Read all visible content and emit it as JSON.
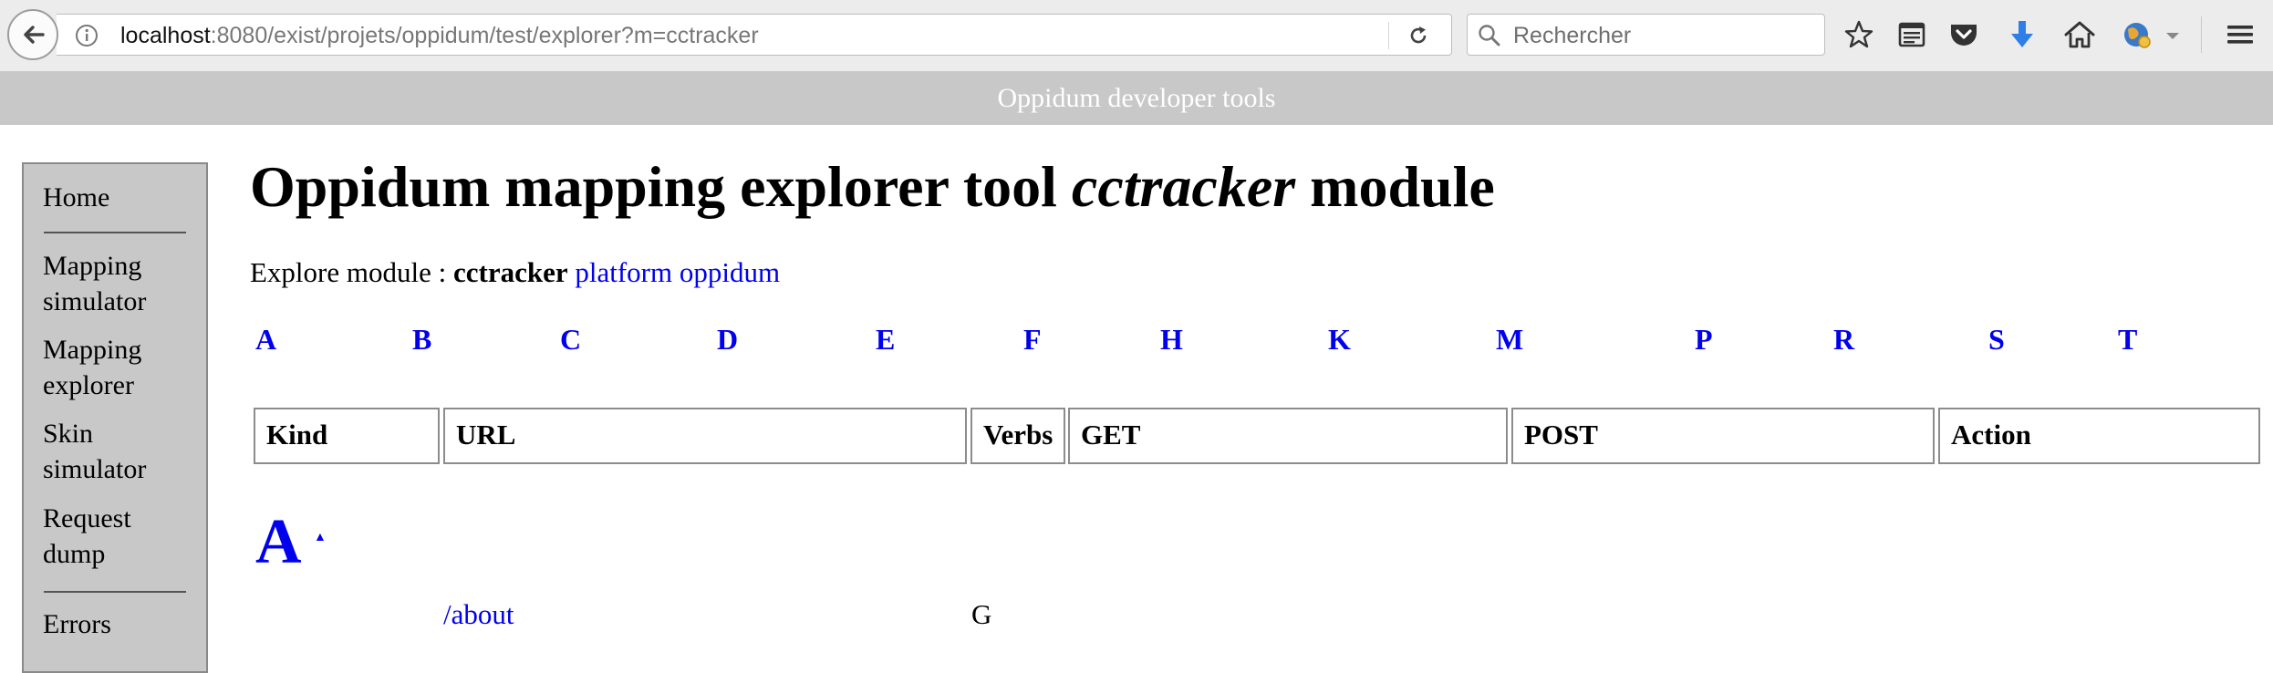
{
  "browser": {
    "url_host": "localhost",
    "url_rest": ":8080/exist/projets/oppidum/test/explorer?m=cctracker",
    "search_placeholder": "Rechercher",
    "colors": {
      "download_arrow": "#2f7fe8",
      "toolbar_bg": "#ececec"
    }
  },
  "page": {
    "header": "Oppidum developer tools",
    "title_part1": "Oppidum mapping explorer tool ",
    "title_module": "cctracker",
    "title_part2": " module",
    "explore_label": "Explore module : ",
    "explore_module": "cctracker",
    "explore_link": "platform oppidum"
  },
  "menu": {
    "home": "Home",
    "items": [
      {
        "line1": "Mapping",
        "line2": "simulator"
      },
      {
        "line1": "Mapping",
        "line2": "explorer"
      },
      {
        "line1": "Skin",
        "line2": "simulator"
      },
      {
        "line1": "Request",
        "line2": "dump"
      }
    ],
    "errors": "Errors"
  },
  "index_letters": [
    "A",
    "B",
    "C",
    "D",
    "E",
    "F",
    "H",
    "K",
    "M",
    "P",
    "R",
    "S",
    "T"
  ],
  "table": {
    "headers": [
      "Kind",
      "URL",
      "Verbs",
      "GET",
      "POST",
      "Action"
    ]
  },
  "section_a": {
    "letter": "A",
    "up_arrow": "▲",
    "row_url": "/about",
    "row_verbs": "G"
  }
}
